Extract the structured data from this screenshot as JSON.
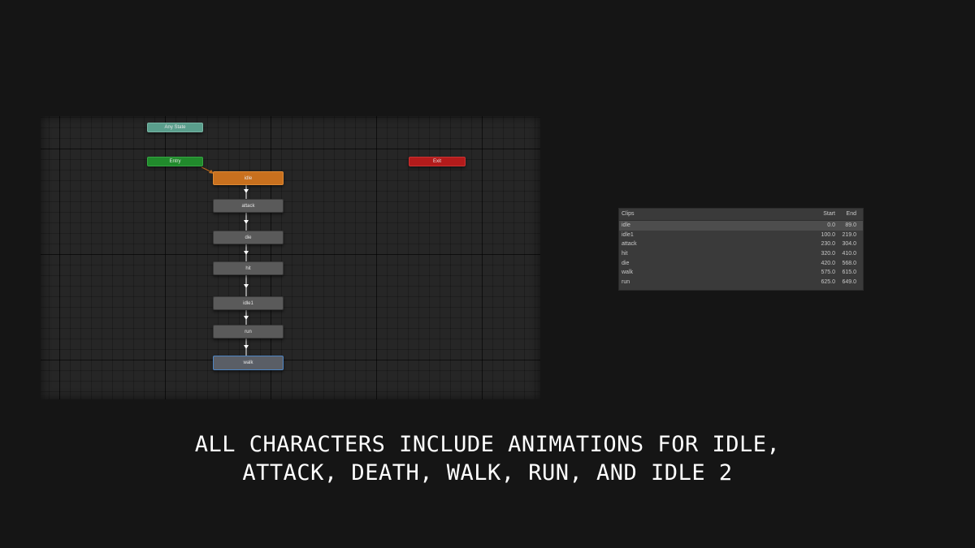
{
  "graph": {
    "any_state": "Any State",
    "entry": "Entry",
    "exit": "Exit",
    "states": [
      "idle",
      "attack",
      "die",
      "hit",
      "idle1",
      "run",
      "walk"
    ]
  },
  "clips": {
    "header": {
      "name": "Clips",
      "start": "Start",
      "end": "End"
    },
    "rows": [
      {
        "name": "idle",
        "start": "0.0",
        "end": "89.0"
      },
      {
        "name": "idle1",
        "start": "100.0",
        "end": "219.0"
      },
      {
        "name": "attack",
        "start": "230.0",
        "end": "304.0"
      },
      {
        "name": "hit",
        "start": "320.0",
        "end": "410.0"
      },
      {
        "name": "die",
        "start": "420.0",
        "end": "568.0"
      },
      {
        "name": "walk",
        "start": "575.0",
        "end": "615.0"
      },
      {
        "name": "run",
        "start": "625.0",
        "end": "649.0"
      }
    ]
  },
  "caption": {
    "line1": "ALL CHARACTERS INCLUDE ANIMATIONS FOR IDLE,",
    "line2": "ATTACK, DEATH, WALK, RUN, AND IDLE 2"
  },
  "colors": {
    "default_state": "#c8701e",
    "entry": "#218a2c",
    "exit": "#b31b1b",
    "any_state": "#5a9e8c",
    "selected_outline": "#4f86c4"
  }
}
